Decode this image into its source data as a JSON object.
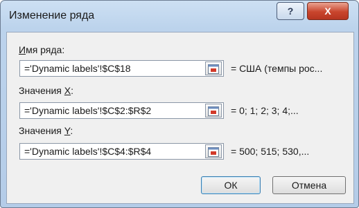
{
  "window": {
    "title": "Изменение ряда"
  },
  "titlebar": {
    "help_label": "?",
    "close_label": "X"
  },
  "series_name": {
    "label_prefix": "",
    "label_underlined": "И",
    "label_rest": "мя ряда:",
    "value": "='Dynamic labels'!$C$18",
    "preview": "= США (темпы рос..."
  },
  "x_values": {
    "label_prefix": "Значения ",
    "label_underlined": "X",
    "label_rest": ":",
    "value": "='Dynamic labels'!$C$2:$R$2",
    "preview": "= 0; 1; 2; 3; 4;..."
  },
  "y_values": {
    "label_prefix": "Значения ",
    "label_underlined": "Y",
    "label_rest": ":",
    "value": "='Dynamic labels'!$C$4:$R$4",
    "preview": "= 500; 515; 530,..."
  },
  "buttons": {
    "ok": "ОК",
    "cancel": "Отмена"
  },
  "icons": {
    "collapse": "collapse-dialog-icon"
  },
  "colors": {
    "titlebar": "#bcd3ec",
    "close": "#c9452d",
    "client": "#f0f0f0"
  }
}
